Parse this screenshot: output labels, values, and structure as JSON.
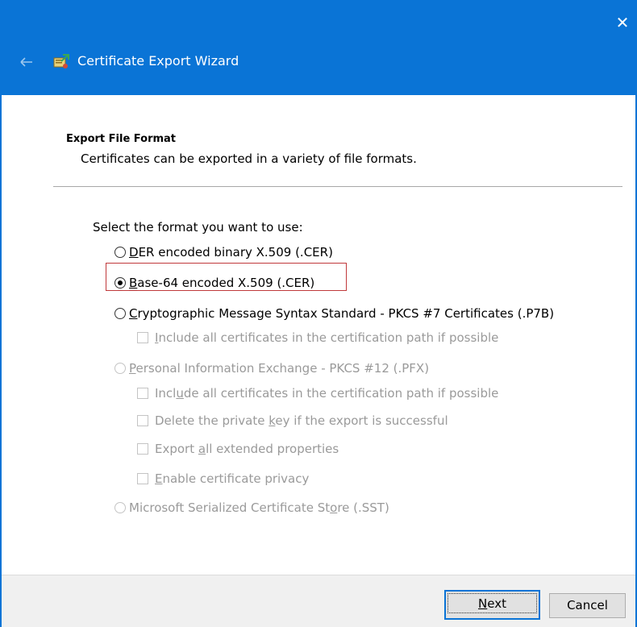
{
  "window": {
    "title": "Certificate Export Wizard",
    "close_glyph": "✕",
    "accent_color": "#0a74d6"
  },
  "page": {
    "heading": "Export File Format",
    "subheading": "Certificates can be exported in a variety of file formats.",
    "prompt": "Select the format you want to use:"
  },
  "options": {
    "der": {
      "label_pre": "",
      "mnemonic": "D",
      "label_post": "ER encoded binary X.509 (.CER)",
      "checked": false,
      "enabled": true
    },
    "base64": {
      "label_pre": "",
      "mnemonic": "B",
      "label_post": "ase-64 encoded X.509 (.CER)",
      "checked": true,
      "enabled": true
    },
    "pkcs7": {
      "label_pre": "",
      "mnemonic": "C",
      "label_post": "ryptographic Message Syntax Standard - PKCS #7 Certificates (.P7B)",
      "checked": false,
      "enabled": true
    },
    "pkcs7_include": {
      "label_pre": "",
      "mnemonic": "I",
      "label_post": "nclude all certificates in the certification path if possible",
      "checked": false,
      "enabled": false
    },
    "pfx": {
      "label_pre": "",
      "mnemonic": "P",
      "label_post": "ersonal Information Exchange - PKCS #12 (.PFX)",
      "checked": false,
      "enabled": false
    },
    "pfx_include": {
      "label_pre": "Incl",
      "mnemonic": "u",
      "label_post": "de all certificates in the certification path if possible",
      "checked": false,
      "enabled": false
    },
    "pfx_delete_key": {
      "label_pre": "Delete the private ",
      "mnemonic": "k",
      "label_post": "ey if the export is successful",
      "checked": false,
      "enabled": false
    },
    "pfx_export_ext": {
      "label_pre": "Export ",
      "mnemonic": "a",
      "label_post": "ll extended properties",
      "checked": false,
      "enabled": false
    },
    "pfx_privacy": {
      "label_pre": "",
      "mnemonic": "E",
      "label_post": "nable certificate privacy",
      "checked": false,
      "enabled": false
    },
    "sst": {
      "label_pre": "Microsoft Serialized Certificate St",
      "mnemonic": "o",
      "label_post": "re (.SST)",
      "checked": false,
      "enabled": false
    }
  },
  "footer": {
    "next_mnemonic": "N",
    "next_rest": "ext",
    "cancel_label": "Cancel"
  }
}
